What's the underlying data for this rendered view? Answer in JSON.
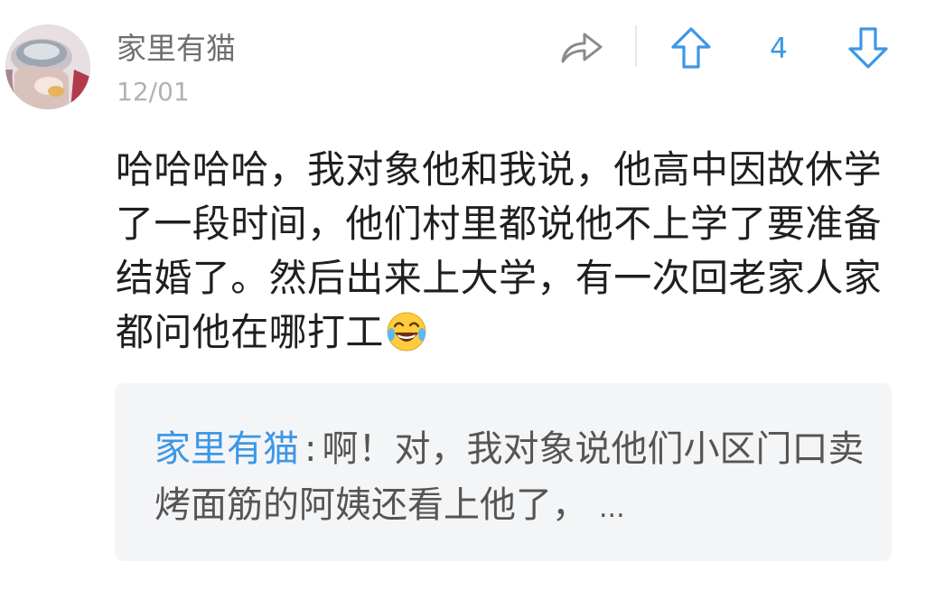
{
  "comment": {
    "author": "家里有猫",
    "date": "12/01",
    "vote_count": "4",
    "body": "哈哈哈哈，我对象他和我说，他高中因故休学了一段时间，他们村里都说他不上学了要准备结婚了。然后出来上大学，有一次回老家人家都问他在哪打工",
    "emoji": "face-with-tears-of-joy"
  },
  "actions": {
    "share_icon": "share-arrow-icon",
    "upvote_icon": "up-arrow-icon",
    "downvote_icon": "down-arrow-icon"
  },
  "reply": {
    "author": "家里有猫",
    "separator": ":",
    "text": "啊！对，我对象说他们小区门口卖烤面筋的阿姨还看上他了，",
    "ellipsis": "..."
  },
  "colors": {
    "accent": "#3d97e5",
    "username": "#6f6f6f",
    "date": "#b2b2b2",
    "body_text": "#1f1f1f",
    "reply_bg": "#f4f5f7"
  }
}
